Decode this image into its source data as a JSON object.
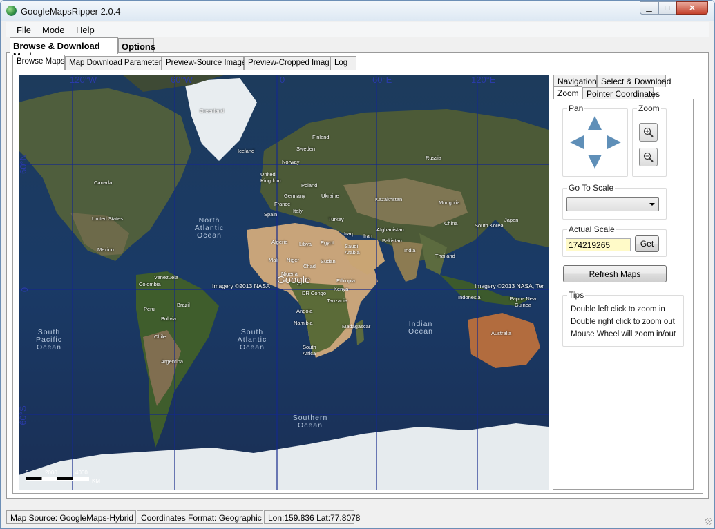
{
  "window": {
    "title": "GoogleMapsRipper 2.0.4"
  },
  "menu": [
    "File",
    "Mode",
    "Help"
  ],
  "main_tabs": [
    {
      "label": "Browse & Download Mode"
    },
    {
      "label": "Options"
    }
  ],
  "sub_tabs": [
    {
      "label": "Browse Maps"
    },
    {
      "label": "Map Download Parameters"
    },
    {
      "label": "Preview-Source Image"
    },
    {
      "label": "Preview-Cropped Image"
    },
    {
      "label": "Log"
    }
  ],
  "map": {
    "grid_lon_labels": [
      "120°W",
      "60°W",
      "0",
      "60°E",
      "120°E"
    ],
    "grid_lat_labels": [
      "60°N",
      "0",
      "60°S"
    ],
    "place_labels": {
      "greenland": "Greenland",
      "iceland": "Iceland",
      "finland": "Finland",
      "sweden": "Sweden",
      "norway": "Norway",
      "russia": "Russia",
      "uk": "United Kingdom",
      "poland": "Poland",
      "germany": "Germany",
      "ukraine": "Ukraine",
      "france": "France",
      "italy": "Italy",
      "spain": "Spain",
      "turkey": "Turkey",
      "kazakhstan": "Kazakhstan",
      "mongolia": "Mongolia",
      "canada": "Canada",
      "us": "United States",
      "mexico": "Mexico",
      "iraq": "Iraq",
      "iran": "Iran",
      "afghanistan": "Afghanistan",
      "pakistan": "Pakistan",
      "china": "China",
      "south_korea": "South Korea",
      "japan": "Japan",
      "algeria": "Algeria",
      "libya": "Libya",
      "egypt": "Egypt",
      "saudi": "Saudi Arabia",
      "mali": "Mali",
      "niger": "Niger",
      "chad": "Chad",
      "sudan": "Sudan",
      "india": "India",
      "thailand": "Thailand",
      "nigeria": "Nigeria",
      "ethiopia": "Ethiopia",
      "kenya": "Kenya",
      "dr_congo": "DR Congo",
      "tanzania": "Tanzania",
      "venezuela": "Venezuela",
      "colombia": "Colombia",
      "peru": "Peru",
      "brazil": "Brazil",
      "bolivia": "Bolivia",
      "chile": "Chile",
      "argentina": "Argentina",
      "angola": "Angola",
      "namibia": "Namibia",
      "south_africa": "South Africa",
      "madagascar": "Madagascar",
      "indonesia": "Indonesia",
      "png": "Papua New Guinea",
      "australia": "Australia"
    },
    "ocean_labels": {
      "north_atlantic": "North Atlantic Ocean",
      "south_pacific": "South Pacific Ocean",
      "south_atlantic": "South Atlantic Ocean",
      "indian": "Indian Ocean",
      "southern": "Southern Ocean"
    },
    "imagery_credit": "Imagery ©2013 NASA",
    "imagery_credit_2": "Imagery ©2013 NASA, Ter",
    "watermark": "Google",
    "scale": {
      "t0": "0",
      "t1": "2000",
      "t2": "4000",
      "unit": "KM"
    }
  },
  "right_panel": {
    "tabs_row1": [
      "Navigation",
      "Select & Download"
    ],
    "tabs_row2": [
      "Zoom",
      "Pointer Coordinates"
    ],
    "pan_title": "Pan",
    "zoom_title": "Zoom",
    "go_to_scale_title": "Go To Scale",
    "go_to_scale_value": "",
    "actual_scale_title": "Actual Scale",
    "actual_scale_value": "174219265",
    "get_label": "Get",
    "refresh_label": "Refresh Maps",
    "tips_title": "Tips",
    "tips": [
      "Double left click to zoom in",
      "Double right click to zoom out",
      "Mouse Wheel will zoom in/out"
    ]
  },
  "status": {
    "source": "Map Source: GoogleMaps-Hybrid",
    "format": "Coordinates Format: Geographic",
    "coords": "Lon:159.836 Lat:77.8078"
  }
}
